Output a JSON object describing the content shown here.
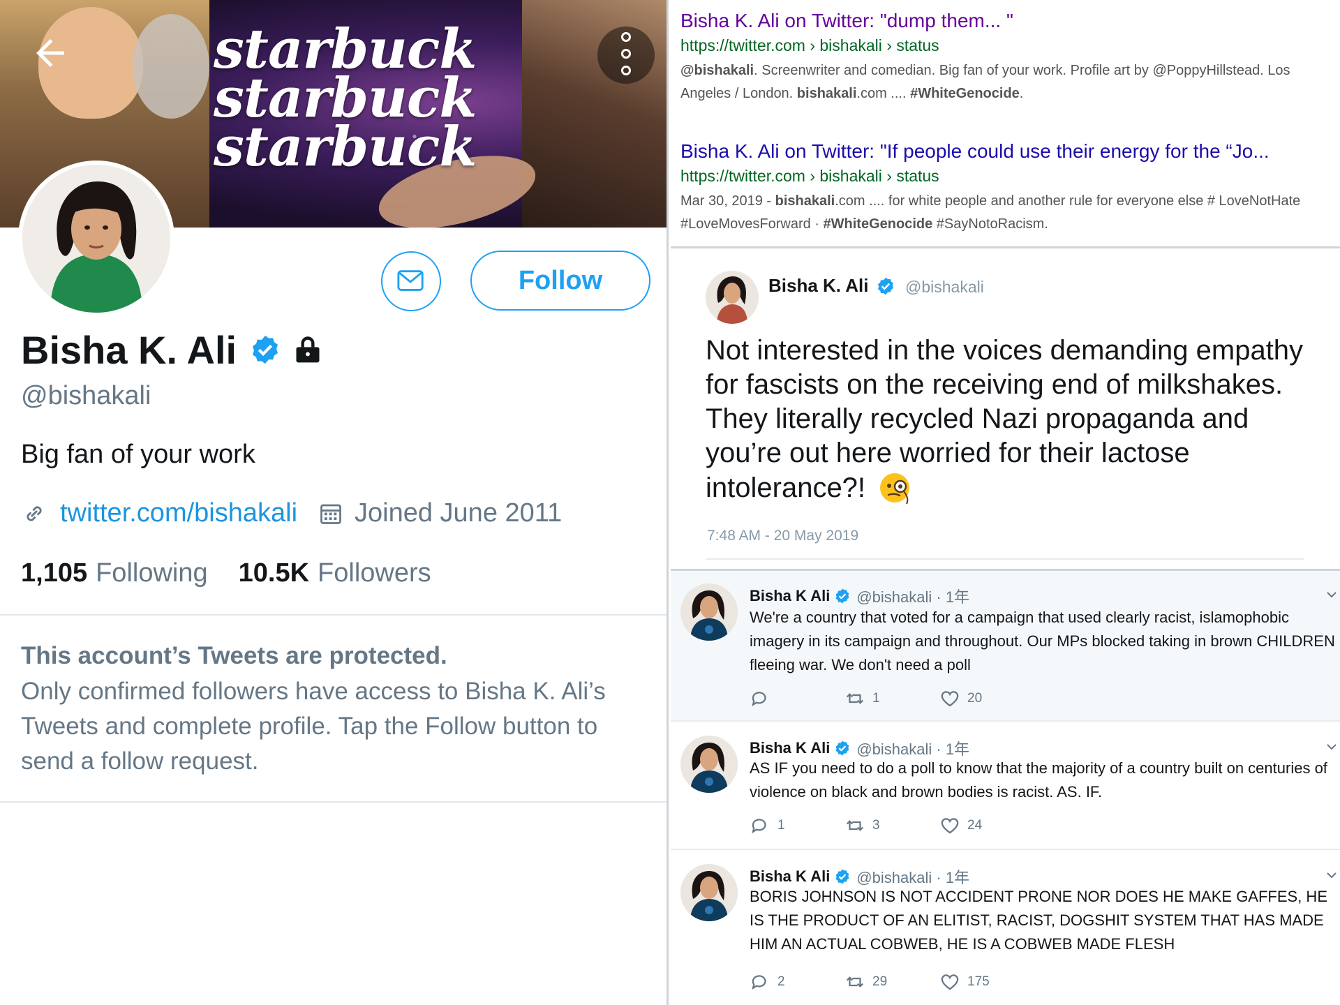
{
  "profile": {
    "banner_text": [
      "starbuck",
      "starbuck",
      "starbuck"
    ],
    "name": "Bisha K. Ali",
    "handle": "@bishakali",
    "bio": "Big fan of your work",
    "link": "twitter.com/bishakali",
    "joined": "Joined June 2011",
    "following_count": "1,105",
    "following_label": "Following",
    "followers_count": "10.5K",
    "followers_label": "Followers",
    "follow_label": "Follow",
    "protected_title": "This account’s Tweets are protected.",
    "protected_body": "Only confirmed followers have access to Bisha K. Ali’s Tweets and complete profile. Tap the Follow button to send a follow request.",
    "colors": {
      "accent": "#1da1f2",
      "link": "#1b95e0",
      "muted": "#657786"
    }
  },
  "search_results": [
    {
      "title": "Bisha K. Ali on Twitter: \"dump them... \"",
      "url": "https://twitter.com › bishakali › status",
      "snippet_html": "<b>@bishakali</b>. Screenwriter and comedian. Big fan of your work. Profile art by @PoppyHillstead. Los Angeles / London. <b>bishakali</b>.com .... <b>#WhiteGenocide</b>."
    },
    {
      "title": "Bisha K. Ali on Twitter: \"If people could use their energy for the “Jo...",
      "url": "https://twitter.com › bishakali › status",
      "snippet_html": "Mar 30, 2019 - <b>bishakali</b>.com .... for white people and another rule for everyone else # LoveNotHate #LoveMovesForward · <b>#WhiteGenocide</b> #SayNotoRacism."
    }
  ],
  "embed": {
    "name": "Bisha K. Ali",
    "handle": "@bishakali",
    "text": "Not interested in the voices demanding empathy for fascists on the receiving end of milkshakes. They literally recycled Nazi propaganda and you’re out here worried for their lactose intolerance?!",
    "emoji_icon": "face-with-monocle-icon",
    "time": "7:48 AM - 20 May 2019"
  },
  "thread": [
    {
      "name": "Bisha K Ali",
      "handle": "@bishakali · 1年",
      "text": "We're a country that voted for a campaign that used clearly racist, islamophobic imagery in its campaign and throughout. Our MPs blocked taking in brown CHILDREN fleeing war. We don't need a poll",
      "replies": "",
      "retweets": "1",
      "likes": "20"
    },
    {
      "name": "Bisha K Ali",
      "handle": "@bishakali · 1年",
      "text": "AS IF you need to do a poll to know that the majority of a country built on centuries of violence on black and brown bodies is racist. AS. IF.",
      "replies": "1",
      "retweets": "3",
      "likes": "24"
    },
    {
      "name": "Bisha K Ali",
      "handle": "@bishakali · 1年",
      "text": "BORIS JOHNSON IS NOT ACCIDENT PRONE NOR DOES HE MAKE GAFFES, HE IS THE PRODUCT OF AN ELITIST, RACIST, DOGSHIT SYSTEM THAT HAS MADE HIM AN ACTUAL COBWEB, HE IS A COBWEB MADE FLESH",
      "replies": "2",
      "retweets": "29",
      "likes": "175"
    }
  ]
}
